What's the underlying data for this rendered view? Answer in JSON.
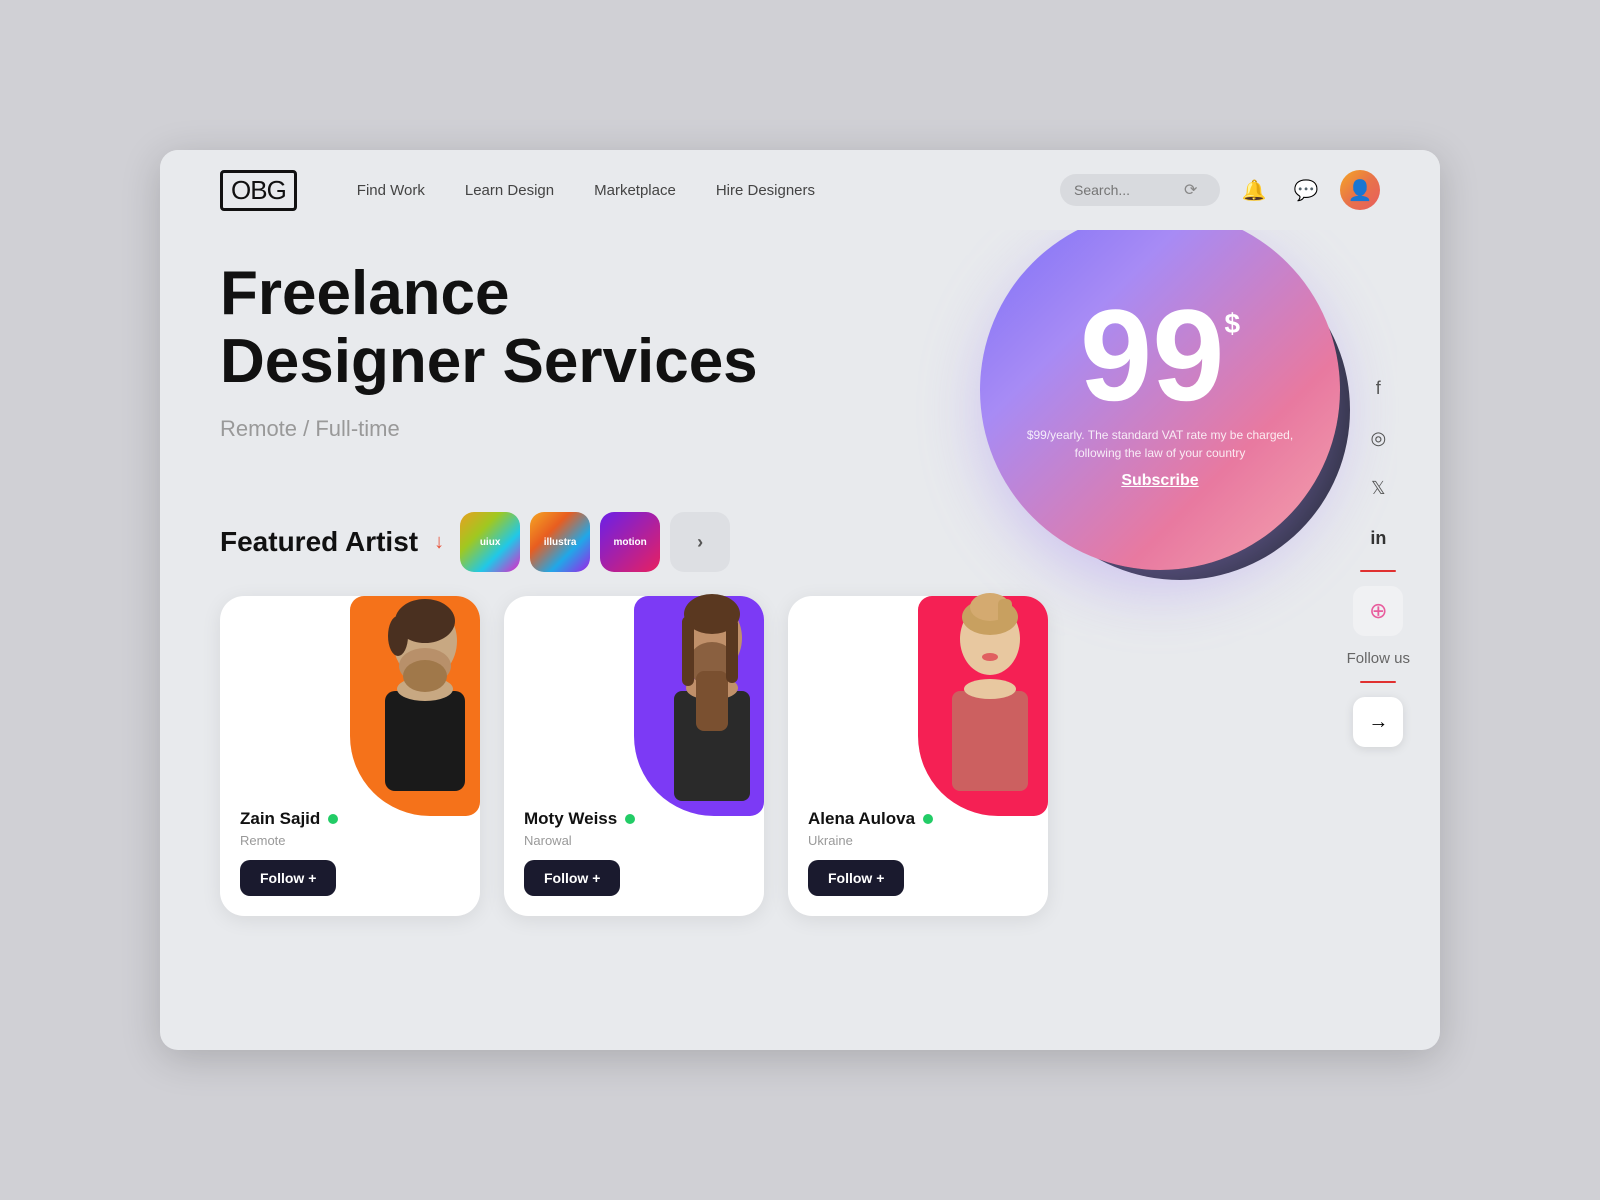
{
  "logo": {
    "text": "OBG"
  },
  "nav": {
    "links": [
      {
        "label": "Find Work",
        "id": "find-work"
      },
      {
        "label": "Learn Design",
        "id": "learn-design"
      },
      {
        "label": "Marketplace",
        "id": "marketplace"
      },
      {
        "label": "Hire Designers",
        "id": "hire-designers"
      }
    ],
    "search_placeholder": "Search..."
  },
  "hero": {
    "title_line1": "Freelance",
    "title_line2": "Designer Services",
    "subtitle": "Remote / Full-time"
  },
  "price_widget": {
    "price": "99",
    "currency": "$",
    "description": "$99/yearly. The standard VAT rate my be charged, following the law of your country",
    "subscribe_label": "Subscribe"
  },
  "featured": {
    "title": "Featured Artist",
    "arrow": "↓",
    "categories": [
      {
        "label": "uiux",
        "id": "uiux"
      },
      {
        "label": "illustra",
        "id": "illustra"
      },
      {
        "label": "motion",
        "id": "motion"
      },
      {
        "label": "›",
        "id": "more"
      }
    ]
  },
  "artists": [
    {
      "name": "Zain Sajid",
      "location": "Remote",
      "online": true,
      "follow_label": "Follow +",
      "bg_color": "orange"
    },
    {
      "name": "Moty Weiss",
      "location": "Narowal",
      "online": true,
      "follow_label": "Follow +",
      "bg_color": "purple"
    },
    {
      "name": "Alena Aulova",
      "location": "Ukraine",
      "online": true,
      "follow_label": "Follow +",
      "bg_color": "red"
    }
  ],
  "social": {
    "follow_label": "Follow us",
    "icons": [
      "f",
      "◎",
      "𝕏",
      "in"
    ],
    "arrow": "→"
  }
}
